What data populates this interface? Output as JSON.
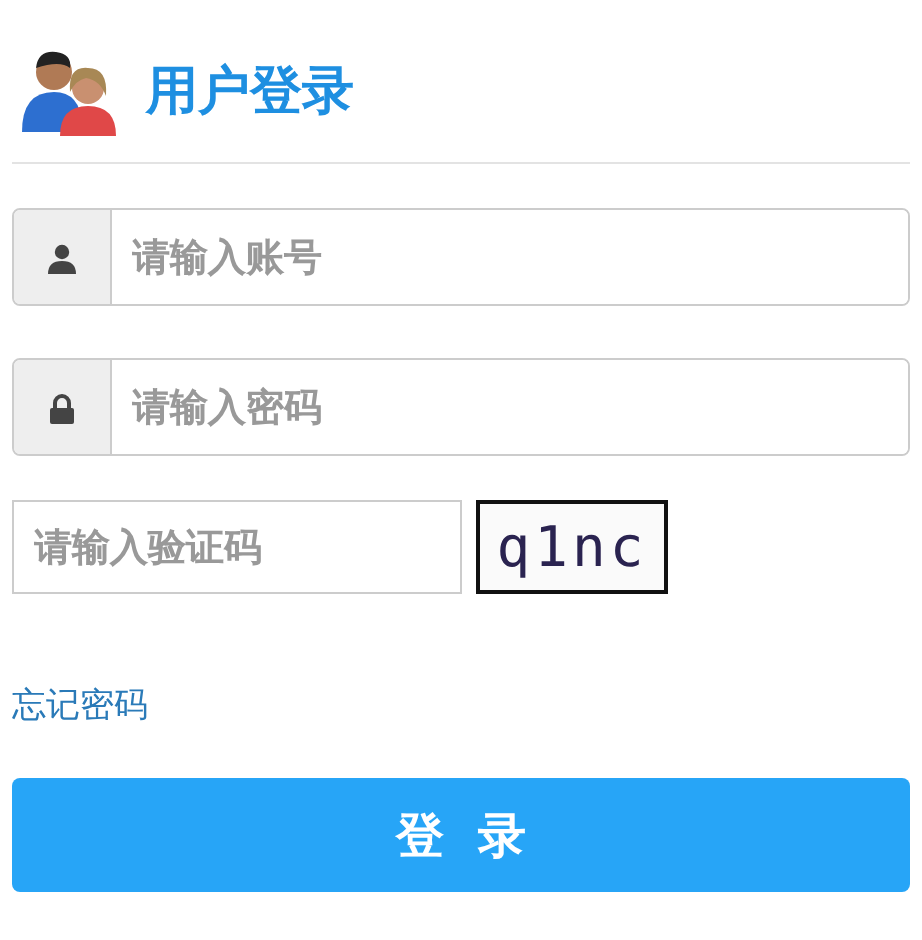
{
  "header": {
    "title": "用户登录"
  },
  "fields": [
    {
      "kind": "user",
      "placeholder": "请输入账号"
    },
    {
      "kind": "lock",
      "placeholder": "请输入密码"
    }
  ],
  "captcha": {
    "placeholder": "请输入验证码",
    "code": "q1nc"
  },
  "forgot_link": "忘记密码",
  "login_button": "登  录"
}
